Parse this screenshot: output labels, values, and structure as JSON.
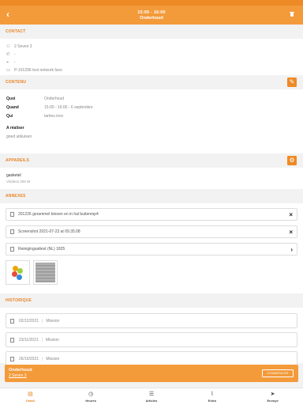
{
  "colors": {
    "accent": "#f39a3a",
    "section_title": "#e98426"
  },
  "header": {
    "time": "15:00 - 16:00",
    "title": "Onderhoud",
    "back_icon": "chevron-left-icon",
    "delete_icon": "trash-icon"
  },
  "contact": {
    "label": "CONTACT",
    "rows": [
      {
        "icon": "person-icon",
        "text": "2 Seven 3"
      },
      {
        "icon": "phone-icon",
        "text": "-"
      },
      {
        "icon": "location-icon",
        "text": "-"
      },
      {
        "icon": "calendar-icon",
        "text": "P-191296 test network favo"
      }
    ]
  },
  "contenu": {
    "label": "CONTENU",
    "rows": [
      {
        "key": "Quoi",
        "value": "Onderhoud"
      },
      {
        "key": "Quand",
        "value": "15:00 - 16:00 - 6 septembre"
      },
      {
        "key": "Qui",
        "value": "tarkeu inoc"
      }
    ],
    "realiser_label": "A réaliser",
    "realiser_value": "goed uitkuisen"
  },
  "appareils": {
    "label": "APPAREILS",
    "name": "gasketel",
    "sub": "Viridens 200 W"
  },
  "annexes": {
    "label": "ANNEXES",
    "files": [
      {
        "name": "201226 gerammel binnen en in hal buitenmp4",
        "action": "×"
      },
      {
        "name": "Screenshot 2021-07-23 at 09.35.08",
        "action": "×"
      },
      {
        "name": "Reinigingsattest (NL) 1825",
        "action": "›"
      }
    ]
  },
  "historique": {
    "label": "HISTORIQUE",
    "items": [
      {
        "date": "02/12/2021",
        "type": "Mission"
      },
      {
        "date": "23/11/2021",
        "type": "Mission"
      },
      {
        "date": "26/10/2021",
        "type": "Mission"
      }
    ]
  },
  "banner": {
    "title": "Onderhoud",
    "subtitle": "2 Seven 3",
    "button": "COMMENCER"
  },
  "tabs": [
    {
      "label": "Détail",
      "icon": "document-icon",
      "glyph": "▤"
    },
    {
      "label": "Heures",
      "icon": "clock-icon",
      "glyph": "◷"
    },
    {
      "label": "Articles",
      "icon": "list-icon",
      "glyph": "☰"
    },
    {
      "label": "Extra",
      "icon": "paperclip-icon",
      "glyph": "⌇"
    },
    {
      "label": "Envoyé",
      "icon": "send-icon",
      "glyph": "➤"
    }
  ]
}
